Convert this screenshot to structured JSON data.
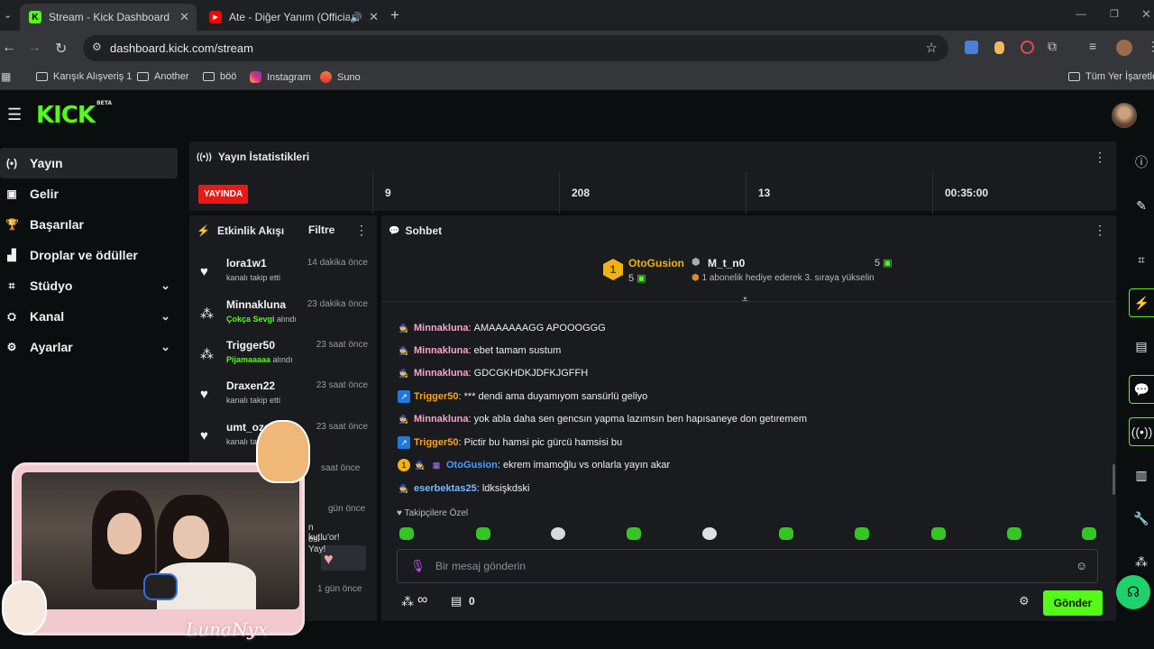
{
  "browser": {
    "tabs": [
      {
        "title": "Stream - Kick Dashboard",
        "active": true
      },
      {
        "title": "Ate - Diğer Yanım (Official V",
        "active": false
      }
    ],
    "url": "dashboard.kick.com/stream",
    "bookmarks": [
      "Karışık Alışveriş 1",
      "Another",
      "böö",
      "Instagram",
      "Suno"
    ],
    "all_bookmarks": "Tüm Yer İşaretleri"
  },
  "kick": {
    "logo": "KICK",
    "logo_badge": "BETA",
    "accent": "#53fc18"
  },
  "sidebar": {
    "items": [
      {
        "label": "Yayın",
        "icon": "broadcast-icon",
        "active": true
      },
      {
        "label": "Gelir",
        "icon": "revenue-icon"
      },
      {
        "label": "Başarılar",
        "icon": "trophy-icon"
      },
      {
        "label": "Droplar ve ödüller",
        "icon": "gift-icon"
      },
      {
        "label": "Stüdyo",
        "icon": "studio-icon",
        "expandable": true
      },
      {
        "label": "Kanal",
        "icon": "channel-icon",
        "expandable": true
      },
      {
        "label": "Ayarlar",
        "icon": "settings-icon",
        "expandable": true
      }
    ]
  },
  "stats": {
    "title": "Yayın İstatistikleri",
    "live_label": "YAYINDA",
    "values": [
      "9",
      "208",
      "13",
      "00:35:00"
    ]
  },
  "activity": {
    "title": "Etkinlik Akışı",
    "filter": "Filtre",
    "events": [
      {
        "user": "lora1w1",
        "time": "14 dakika önce",
        "pre": "kanalı takip etti",
        "highlight": "",
        "post": "",
        "icon": "heart-icon"
      },
      {
        "user": "Minnakluna",
        "time": "23 dakika önce",
        "pre": "",
        "highlight": "Çokça Sevgi",
        "post": " alındı",
        "icon": "points-icon"
      },
      {
        "user": "Trigger50",
        "time": "23 saat önce",
        "pre": "",
        "highlight": "Pijamaaaaa",
        "post": " alındı",
        "icon": "points-icon"
      },
      {
        "user": "Draxen22",
        "time": "23 saat önce",
        "pre": "kanalı takip etti",
        "highlight": "",
        "post": "",
        "icon": "heart-icon"
      },
      {
        "user": "umt_ozg",
        "time": "23 saat önce",
        "pre": "kanalı takip etti",
        "highlight": "",
        "post": "",
        "icon": "heart-icon"
      }
    ],
    "partial_times": [
      "saat önce",
      "gün önce",
      "1 gün önce"
    ]
  },
  "chat": {
    "title": "Sohbet",
    "pinned": {
      "rank": "1",
      "user1": "OtoGusion",
      "user1_count": "5",
      "user2": "M_t_n0",
      "user2_count": "5",
      "note": "1 abonelik hediye ederek 3. sıraya yükselin"
    },
    "messages": [
      {
        "user": "Minnakluna",
        "text": "AMAAAAAAGG APOOOGGG",
        "color": "#f7a6c8"
      },
      {
        "user": "Minnakluna",
        "text": "ebet tamam sustum",
        "color": "#f7a6c8"
      },
      {
        "user": "Minnakluna",
        "text": "GDCGKHDKJDFKJGFFH",
        "color": "#f7a6c8"
      },
      {
        "user": "Trigger50",
        "text": "*** dendi ama duyamıyom sansürlü geliyo",
        "color": "#f6a623"
      },
      {
        "user": "Minnakluna",
        "text": "yok abla daha sen gencsın yapma lazımsın ben hapısaneye don getıremem",
        "color": "#f7a6c8"
      },
      {
        "user": "Trigger50",
        "text": "Pictir bu hamsi pic gürcü hamsisi bu",
        "color": "#f6a623"
      },
      {
        "user": "OtoGusion",
        "text": "ekrem imamoğlu vs onlarla yayın akar",
        "color": "#4a9cff"
      },
      {
        "user": "eserbektas25",
        "text": "ldksişkdski",
        "color": "#7cb7ff"
      }
    ],
    "followers_only": "Takipçilere Özel",
    "input_placeholder": "Bir mesaj gönderin",
    "points_label": "∞",
    "store_count": "0",
    "send_label": "Gönder"
  },
  "overlay": {
    "signature": "LunaNyx",
    "banner_partial_1": "n kutlu'or!",
    "banner_partial_2": "esi - Yay!"
  }
}
